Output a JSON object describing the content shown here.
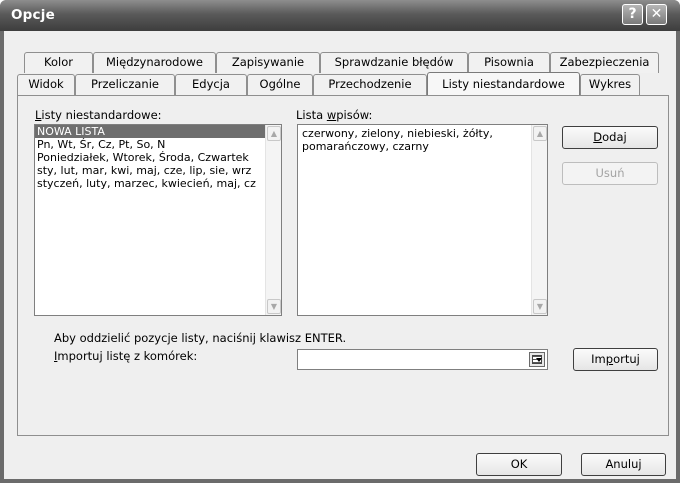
{
  "window": {
    "title": "Opcje",
    "help_glyph": "?",
    "close_glyph": "✕"
  },
  "tabs_back": [
    "Kolor",
    "Międzynarodowe",
    "Zapisywanie",
    "Sprawdzanie błędów",
    "Pisownia",
    "Zabezpieczenia"
  ],
  "tabs_front": [
    "Widok",
    "Przeliczanie",
    "Edycja",
    "Ogólne",
    "Przechodzenie",
    "Listy niestandardowe",
    "Wykres"
  ],
  "active_tab": "Listy niestandardowe",
  "custom_lists": {
    "label_mnemonic": "L",
    "label_rest": "isty niestandardowe:",
    "items": [
      "NOWA LISTA",
      "Pn, Wt, Śr, Cz, Pt, So, N",
      "Poniedziałek, Wtorek, Środa, Czwartek",
      "sty, lut, mar, kwi, maj, cze, lip, sie, wrz",
      "styczeń, luty, marzec, kwiecień, maj, cz"
    ],
    "selected_index": 0
  },
  "entries": {
    "label_prefix": "Lista ",
    "label_mnemonic": "w",
    "label_rest": "pisów:",
    "text": "czerwony, zielony, niebieski, żółty,\npomarańczowy, czarny"
  },
  "buttons": {
    "add_mnemonic": "D",
    "add_rest": "odaj",
    "remove": "Usuń",
    "import_prefix": "Im",
    "import_mnemonic": "p",
    "import_rest": "ortuj",
    "ok": "OK",
    "cancel": "Anuluj"
  },
  "hint": "Aby oddzielić pozycje listy, naciśnij klawisz ENTER.",
  "import_from": {
    "label_mnemonic": "I",
    "label_rest": "mportuj listę z komórek:",
    "value": ""
  },
  "icons": {
    "scroll_up": "scroll-up-arrow-icon",
    "scroll_down": "scroll-down-arrow-icon",
    "range_picker": "range-picker-icon"
  }
}
